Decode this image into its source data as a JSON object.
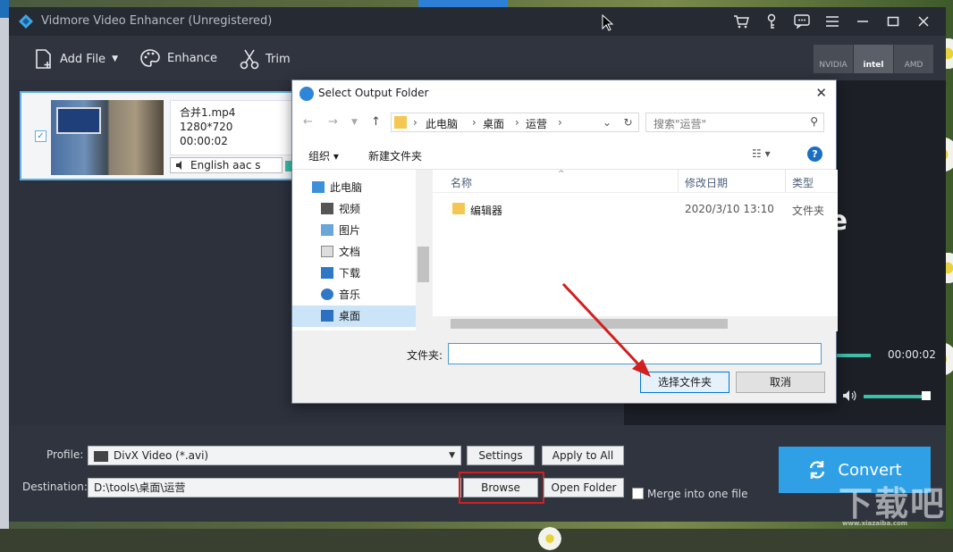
{
  "app": {
    "title": "Vidmore Video Enhancer (Unregistered)",
    "toolbar": {
      "add_file": "Add File",
      "enhance": "Enhance",
      "trim": "Trim"
    },
    "gpu": [
      "NVIDIA",
      "intel",
      "AMD"
    ],
    "file": {
      "name": "合并1.mp4",
      "resolution": "1280*720",
      "duration": "00:00:02",
      "audio": "English aac s"
    },
    "preview": {
      "time": "00:00:02",
      "overlay_text": "re"
    },
    "bottom": {
      "profile_label": "Profile:",
      "profile_value": "DivX Video (*.avi)",
      "settings": "Settings",
      "apply_all": "Apply to All",
      "destination_label": "Destination:",
      "destination_value": "D:\\tools\\桌面\\运营",
      "browse": "Browse",
      "open_folder": "Open Folder",
      "merge": "Merge into one file",
      "convert": "Convert"
    }
  },
  "dialog": {
    "title": "Select Output Folder",
    "breadcrumb": [
      "此电脑",
      "桌面",
      "运营"
    ],
    "search_placeholder": "搜索\"运营\"",
    "organize": "组织 ▾",
    "new_folder": "新建文件夹",
    "tree": [
      "此电脑",
      "视频",
      "图片",
      "文档",
      "下载",
      "音乐",
      "桌面"
    ],
    "columns": {
      "name": "名称",
      "date": "修改日期",
      "type": "类型"
    },
    "rows": [
      {
        "name": "编辑器",
        "date": "2020/3/10 13:10",
        "type": "文件夹"
      }
    ],
    "folder_label": "文件夹:",
    "select": "选择文件夹",
    "cancel": "取消"
  },
  "watermark": {
    "text": "下载吧",
    "sub": "www.xiazaiba.com"
  },
  "colors": {
    "accent": "#2fa0e6",
    "teal": "#3bbfa9",
    "highlight_red": "#d21f1f"
  }
}
